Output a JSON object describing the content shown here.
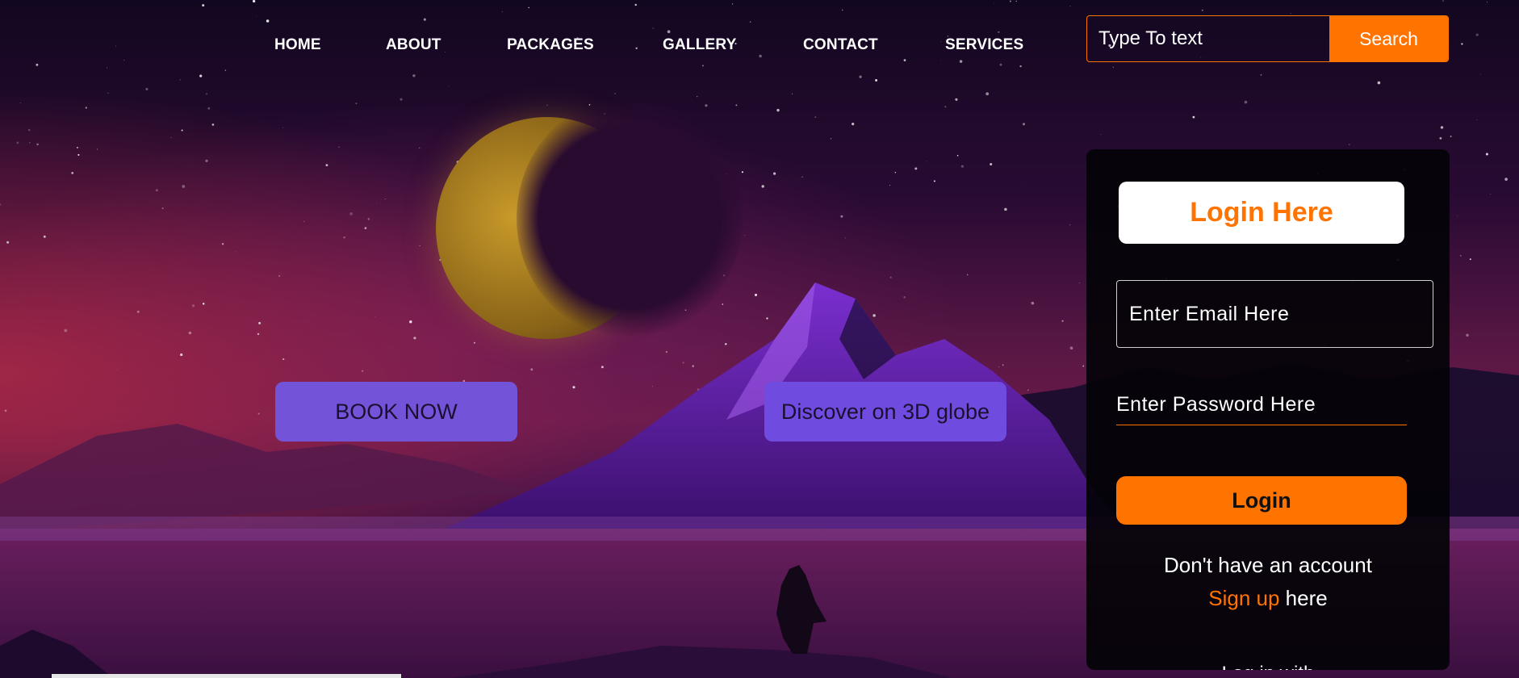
{
  "nav": {
    "items": [
      "HOME",
      "ABOUT",
      "PACKAGES",
      "GALLERY",
      "CONTACT",
      "SERVICES"
    ]
  },
  "search": {
    "placeholder": "Type To text",
    "button_label": "Search"
  },
  "hero": {
    "book_label": "BOOK NOW",
    "globe_label": "Discover on 3D globe"
  },
  "login": {
    "title": "Login Here",
    "email_placeholder": "Enter Email Here",
    "password_placeholder": "Enter Password Here",
    "button_label": "Login",
    "no_account_text": "Don't have an account",
    "signup_link": "Sign up",
    "signup_suffix": " here",
    "login_with": "Log in with"
  },
  "colors": {
    "accent": "#ff7300",
    "cta": "#7353d8",
    "panel": "#040308"
  }
}
